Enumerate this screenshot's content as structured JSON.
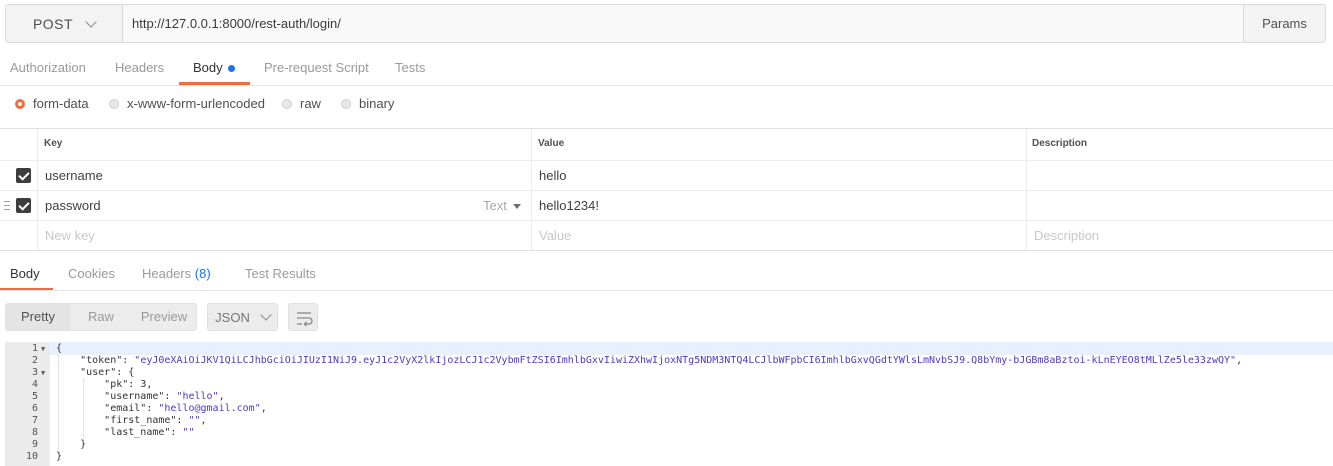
{
  "request": {
    "method": "POST",
    "url": "http://127.0.0.1:8000/rest-auth/login/",
    "params_label": "Params"
  },
  "request_tabs": [
    {
      "label": "Authorization"
    },
    {
      "label": "Headers"
    },
    {
      "label": "Body"
    },
    {
      "label": "Pre-request Script"
    },
    {
      "label": "Tests"
    }
  ],
  "body_modes": [
    {
      "label": "form-data",
      "selected": true
    },
    {
      "label": "x-www-form-urlencoded",
      "selected": false
    },
    {
      "label": "raw",
      "selected": false
    },
    {
      "label": "binary",
      "selected": false
    }
  ],
  "form_table": {
    "headers": {
      "key": "Key",
      "value": "Value",
      "description": "Description"
    },
    "rows": [
      {
        "key": "username",
        "value": "hello",
        "checked": true
      },
      {
        "key": "password",
        "value": "hello1234!",
        "checked": true,
        "type": "Text"
      }
    ],
    "new_row": {
      "key_placeholder": "New key",
      "value_placeholder": "Value",
      "description_placeholder": "Description"
    }
  },
  "response_tabs": {
    "body": "Body",
    "cookies": "Cookies",
    "headers": "Headers",
    "headers_count": "(8)",
    "test_results": "Test Results"
  },
  "response_toolbar": {
    "views": [
      "Pretty",
      "Raw",
      "Preview"
    ],
    "format": "JSON"
  },
  "response_body": {
    "line_numbers": [
      "1",
      "2",
      "3",
      "4",
      "5",
      "6",
      "7",
      "8",
      "9",
      "10"
    ],
    "lines": {
      "l1": "{",
      "l2_key": "\"token\"",
      "l2_val": "\"eyJ0eXAiOiJKV1QiLCJhbGciOiJIUzI1NiJ9.eyJ1c2VyX2lkIjozLCJ1c2VybmFtZSI6ImhlbGxvIiwiZXhwIjoxNTg5NDM3NTQ4LCJlbWFpbCI6ImhlbGxvQGdtYWlsLmNvbSJ9.Q8bYmy-bJGBm8aBztoi-kLnEYEO8tMLlZe5le33zwQY\"",
      "l3_key": "\"user\"",
      "l4_key": "\"pk\"",
      "l4_val": "3",
      "l5_key": "\"username\"",
      "l5_val": "\"hello\"",
      "l6_key": "\"email\"",
      "l6_val": "\"hello@gmail.com\"",
      "l7_key": "\"first_name\"",
      "l7_val": "\"\"",
      "l8_key": "\"last_name\"",
      "l8_val": "\"\"",
      "l9": "}",
      "l10": "}"
    }
  }
}
